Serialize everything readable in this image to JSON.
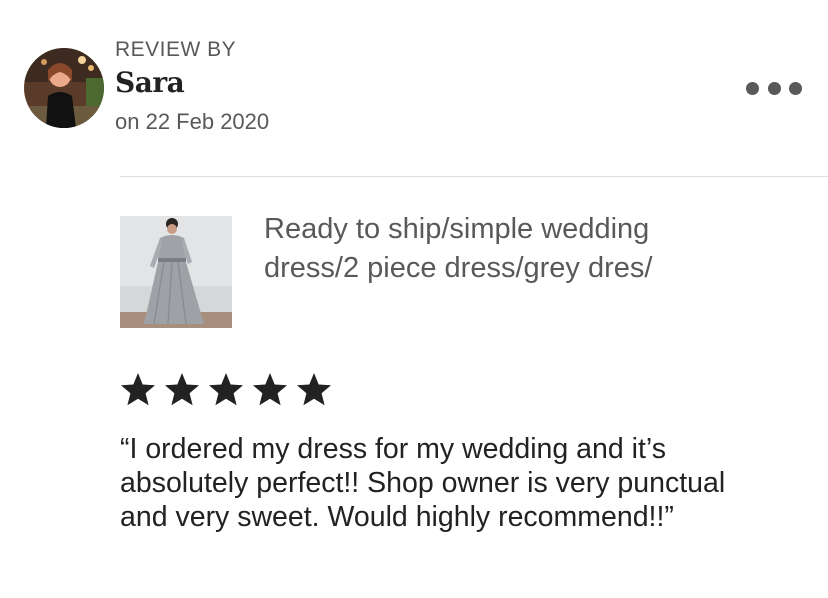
{
  "review": {
    "label": "REVIEW BY",
    "reviewer_name": "Sara",
    "date": "on 22 Feb 2020",
    "rating": 5,
    "rating_max": 5,
    "text": "“I ordered my dress for my wedding and it’s absolutely perfect!! Shop owner is very punctual and very sweet. Would highly recommend!!”"
  },
  "listing": {
    "title": "Ready to ship/simple wedding dress/2 piece dress/grey dres/"
  },
  "icons": {
    "more": "more-horizontal-icon",
    "star": "star-filled-icon"
  },
  "colors": {
    "text_primary": "#222222",
    "text_secondary": "#595959",
    "divider": "#dddddd",
    "star": "#222222"
  }
}
